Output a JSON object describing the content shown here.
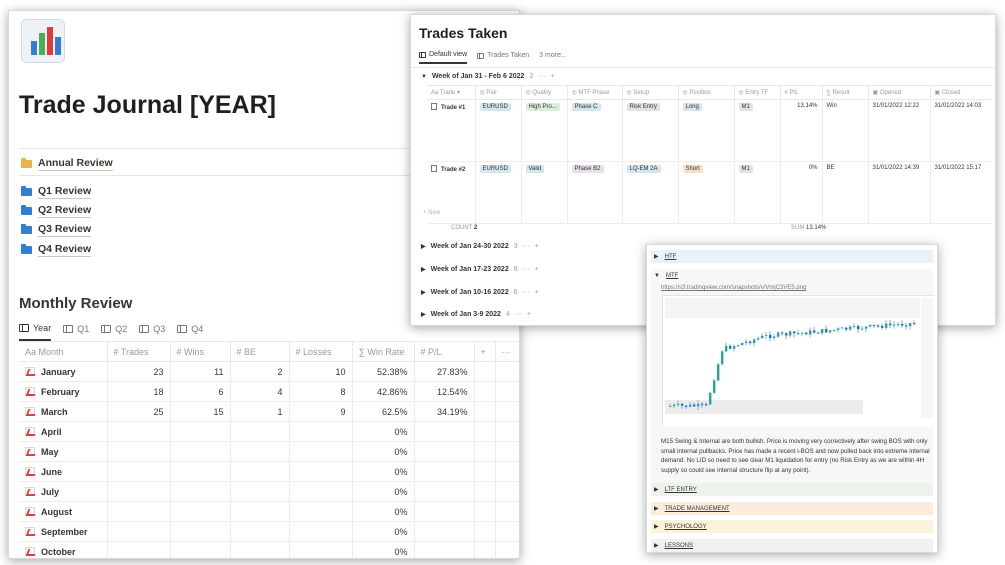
{
  "journal": {
    "title": "Trade Journal [YEAR]",
    "annual_link": "Annual Review",
    "quarters": [
      "Q1 Review",
      "Q2 Review",
      "Q3 Review",
      "Q4 Review"
    ],
    "monthly_title": "Monthly Review",
    "tabs": [
      "Year",
      "Q1",
      "Q2",
      "Q3",
      "Q4"
    ],
    "columns": [
      "Aa Month",
      "# Trades",
      "# Wins",
      "# BE",
      "# Losses",
      "∑ Win Rate",
      "# P/L",
      "+",
      "···"
    ],
    "rows": [
      {
        "month": "January",
        "trades": "23",
        "wins": "11",
        "be": "2",
        "losses": "10",
        "win_rate": "52.38%",
        "pl": "27.83%"
      },
      {
        "month": "February",
        "trades": "18",
        "wins": "6",
        "be": "4",
        "losses": "8",
        "win_rate": "42.86%",
        "pl": "12.54%"
      },
      {
        "month": "March",
        "trades": "25",
        "wins": "15",
        "be": "1",
        "losses": "9",
        "win_rate": "62.5%",
        "pl": "34.19%"
      },
      {
        "month": "April",
        "trades": "",
        "wins": "",
        "be": "",
        "losses": "",
        "win_rate": "0%",
        "pl": ""
      },
      {
        "month": "May",
        "trades": "",
        "wins": "",
        "be": "",
        "losses": "",
        "win_rate": "0%",
        "pl": ""
      },
      {
        "month": "June",
        "trades": "",
        "wins": "",
        "be": "",
        "losses": "",
        "win_rate": "0%",
        "pl": ""
      },
      {
        "month": "July",
        "trades": "",
        "wins": "",
        "be": "",
        "losses": "",
        "win_rate": "0%",
        "pl": ""
      },
      {
        "month": "August",
        "trades": "",
        "wins": "",
        "be": "",
        "losses": "",
        "win_rate": "0%",
        "pl": ""
      },
      {
        "month": "September",
        "trades": "",
        "wins": "",
        "be": "",
        "losses": "",
        "win_rate": "0%",
        "pl": ""
      },
      {
        "month": "October",
        "trades": "",
        "wins": "",
        "be": "",
        "losses": "",
        "win_rate": "0%",
        "pl": ""
      }
    ]
  },
  "trades": {
    "title": "Trades Taken",
    "tabs": [
      "Default view",
      "Trades Taken",
      "3 more..."
    ],
    "group_open": {
      "label": "Week of Jan 31 - Feb 6 2022",
      "count": "2"
    },
    "columns": [
      "Aa Trade ▾",
      "◎ Pair",
      "◎ Quality",
      "◎ MTF Phase",
      "◎ Setup",
      "◎ Position",
      "◎ Entry TF",
      "# P/L",
      "∑ Result",
      "▣ Opened",
      "▣ Closed"
    ],
    "rows": [
      {
        "trade": "Trade #1",
        "pair": "EURUSD",
        "quality": "High Pro...",
        "phase": "Phase C",
        "setup": "Risk Entry",
        "position": "Long",
        "entry_tf": "M1",
        "pl": "13.14%",
        "result": "Win",
        "opened": "31/01/2022 12:22",
        "closed": "31/01/2022 14:03"
      },
      {
        "trade": "Trade #2",
        "pair": "EURUSD",
        "quality": "Valid",
        "phase": "Phase B2",
        "setup": "LQ-EM 2A",
        "position": "Short",
        "entry_tf": "M1",
        "pl": "0%",
        "result": "BE",
        "opened": "31/01/2022 14:39",
        "closed": "31/01/2022 15:17"
      }
    ],
    "new_label": "+ New",
    "count_label": "COUNT",
    "count_value": "2",
    "sum_label": "SUM",
    "sum_value": "13.14%",
    "collapsed_groups": [
      {
        "label": "Week of Jan 24-30 2022",
        "count": "3"
      },
      {
        "label": "Week of Jan 17-23 2022",
        "count": "8"
      },
      {
        "label": "Week of Jan 10-16 2022",
        "count": "6"
      },
      {
        "label": "Week of Jan 3-9 2022",
        "count": "4"
      }
    ]
  },
  "mtf": {
    "toggles_top": [
      "HTF",
      "MTF"
    ],
    "url": "https://s3.tradingview.com/snapshots/v/VmjC3VE5.png",
    "description": "M15 Swing & Internal are both bullish. Price is moving very correctively after swing BOS with only small internal pullbacks. Price has made a recent i-BOS and now pulled back into extreme internal demand. No LID so need to see clear M1 liquidation for entry (no Risk Entry as we are within 4H supply so could see internal structure flip at any point).",
    "toggles_bottom": [
      {
        "label": "LTF ENTRY",
        "color": "#edf3ec"
      },
      {
        "label": "TRADE MANAGEMENT",
        "color": "#fbecdd"
      },
      {
        "label": "PSYCHOLOGY",
        "color": "#fbf3db"
      },
      {
        "label": "LESSONS",
        "color": "#f1f1ef"
      }
    ]
  },
  "colors": {
    "pill_gray": "#e3e2e0",
    "pill_blue": "#d3e5ef",
    "pill_green": "#dbeddb",
    "pill_purple": "#e8deee",
    "pill_orange": "#fadec9",
    "htf_bg": "#e7f3f8",
    "chart_green": "#26a69a",
    "chart_blue": "#2962ff"
  }
}
